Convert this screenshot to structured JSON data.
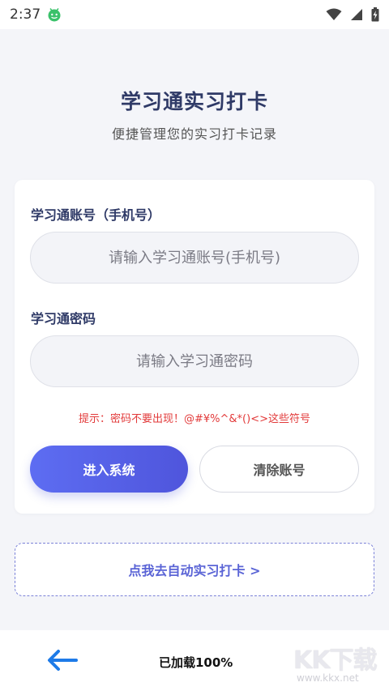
{
  "status_bar": {
    "time": "2:37",
    "icons": [
      "android-app-icon",
      "wifi-icon",
      "signal-icon",
      "battery-icon"
    ]
  },
  "header": {
    "title": "学习通实习打卡",
    "subtitle": "便捷管理您的实习打卡记录"
  },
  "login_form": {
    "account_label": "学习通账号（手机号）",
    "account_placeholder": "请输入学习通账号(手机号)",
    "password_label": "学习通密码",
    "password_placeholder": "请输入学习通密码",
    "hint": "提示：密码不要出现！@#¥%^&*()<>这些符号",
    "enter_button": "进入系统",
    "clear_button": "清除账号"
  },
  "auto_checkin_link": "点我去自动实习打卡 >",
  "bottom_bar": {
    "back_icon": "arrow-left-icon",
    "loaded_text": "已加载100%"
  },
  "watermark": {
    "logo": "KK下载",
    "url": "www.kkx.net"
  },
  "colors": {
    "title": "#2f3a67",
    "accent": "#5a64d6",
    "hint": "#e23a3a",
    "back_arrow": "#1e7be8"
  }
}
